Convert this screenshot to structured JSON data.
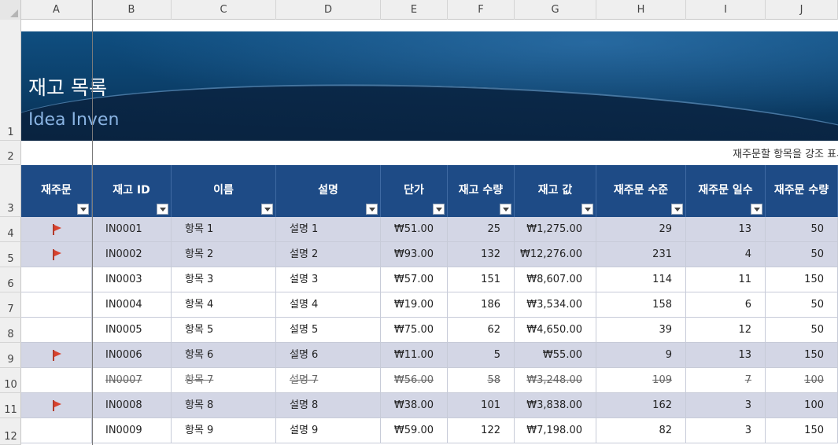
{
  "columns": [
    "A",
    "B",
    "C",
    "D",
    "E",
    "F",
    "G",
    "H",
    "I",
    "J"
  ],
  "row_numbers": [
    "1",
    "2",
    "3",
    "4",
    "5",
    "6",
    "7",
    "8",
    "9",
    "10",
    "11",
    "12"
  ],
  "banner": {
    "title": "재고 목록",
    "subtitle": "Idea Inven"
  },
  "hint": "재주문할 항목을 강조 표시할까",
  "headers": [
    "재주문",
    "재고 ID",
    "이름",
    "설명",
    "단가",
    "재고 수량",
    "재고 값",
    "재주문 수준",
    "재주문 일수",
    "재주문 수량"
  ],
  "colors": {
    "header_bg": "#1e4b86",
    "highlight_row": "#d3d6e5",
    "flag": "#d8422e"
  },
  "rows": [
    {
      "flag": true,
      "strike": false,
      "id": "IN0001",
      "name": "항목 1",
      "desc": "설명 1",
      "price": "₩51.00",
      "qty": "25",
      "value": "₩1,275.00",
      "level": "29",
      "days": "13",
      "reorder": "50"
    },
    {
      "flag": true,
      "strike": false,
      "id": "IN0002",
      "name": "항목 2",
      "desc": "설명 2",
      "price": "₩93.00",
      "qty": "132",
      "value": "₩12,276.00",
      "level": "231",
      "days": "4",
      "reorder": "50"
    },
    {
      "flag": false,
      "strike": false,
      "id": "IN0003",
      "name": "항목 3",
      "desc": "설명 3",
      "price": "₩57.00",
      "qty": "151",
      "value": "₩8,607.00",
      "level": "114",
      "days": "11",
      "reorder": "150"
    },
    {
      "flag": false,
      "strike": false,
      "id": "IN0004",
      "name": "항목 4",
      "desc": "설명 4",
      "price": "₩19.00",
      "qty": "186",
      "value": "₩3,534.00",
      "level": "158",
      "days": "6",
      "reorder": "50"
    },
    {
      "flag": false,
      "strike": false,
      "id": "IN0005",
      "name": "항목 5",
      "desc": "설명 5",
      "price": "₩75.00",
      "qty": "62",
      "value": "₩4,650.00",
      "level": "39",
      "days": "12",
      "reorder": "50"
    },
    {
      "flag": true,
      "strike": false,
      "id": "IN0006",
      "name": "항목 6",
      "desc": "설명 6",
      "price": "₩11.00",
      "qty": "5",
      "value": "₩55.00",
      "level": "9",
      "days": "13",
      "reorder": "150"
    },
    {
      "flag": false,
      "strike": true,
      "id": "IN0007",
      "name": "항목 7",
      "desc": "설명 7",
      "price": "₩56.00",
      "qty": "58",
      "value": "₩3,248.00",
      "level": "109",
      "days": "7",
      "reorder": "100"
    },
    {
      "flag": true,
      "strike": false,
      "id": "IN0008",
      "name": "항목 8",
      "desc": "설명 8",
      "price": "₩38.00",
      "qty": "101",
      "value": "₩3,838.00",
      "level": "162",
      "days": "3",
      "reorder": "100"
    },
    {
      "flag": false,
      "strike": false,
      "id": "IN0009",
      "name": "항목 9",
      "desc": "설명 9",
      "price": "₩59.00",
      "qty": "122",
      "value": "₩7,198.00",
      "level": "82",
      "days": "3",
      "reorder": "150"
    }
  ]
}
